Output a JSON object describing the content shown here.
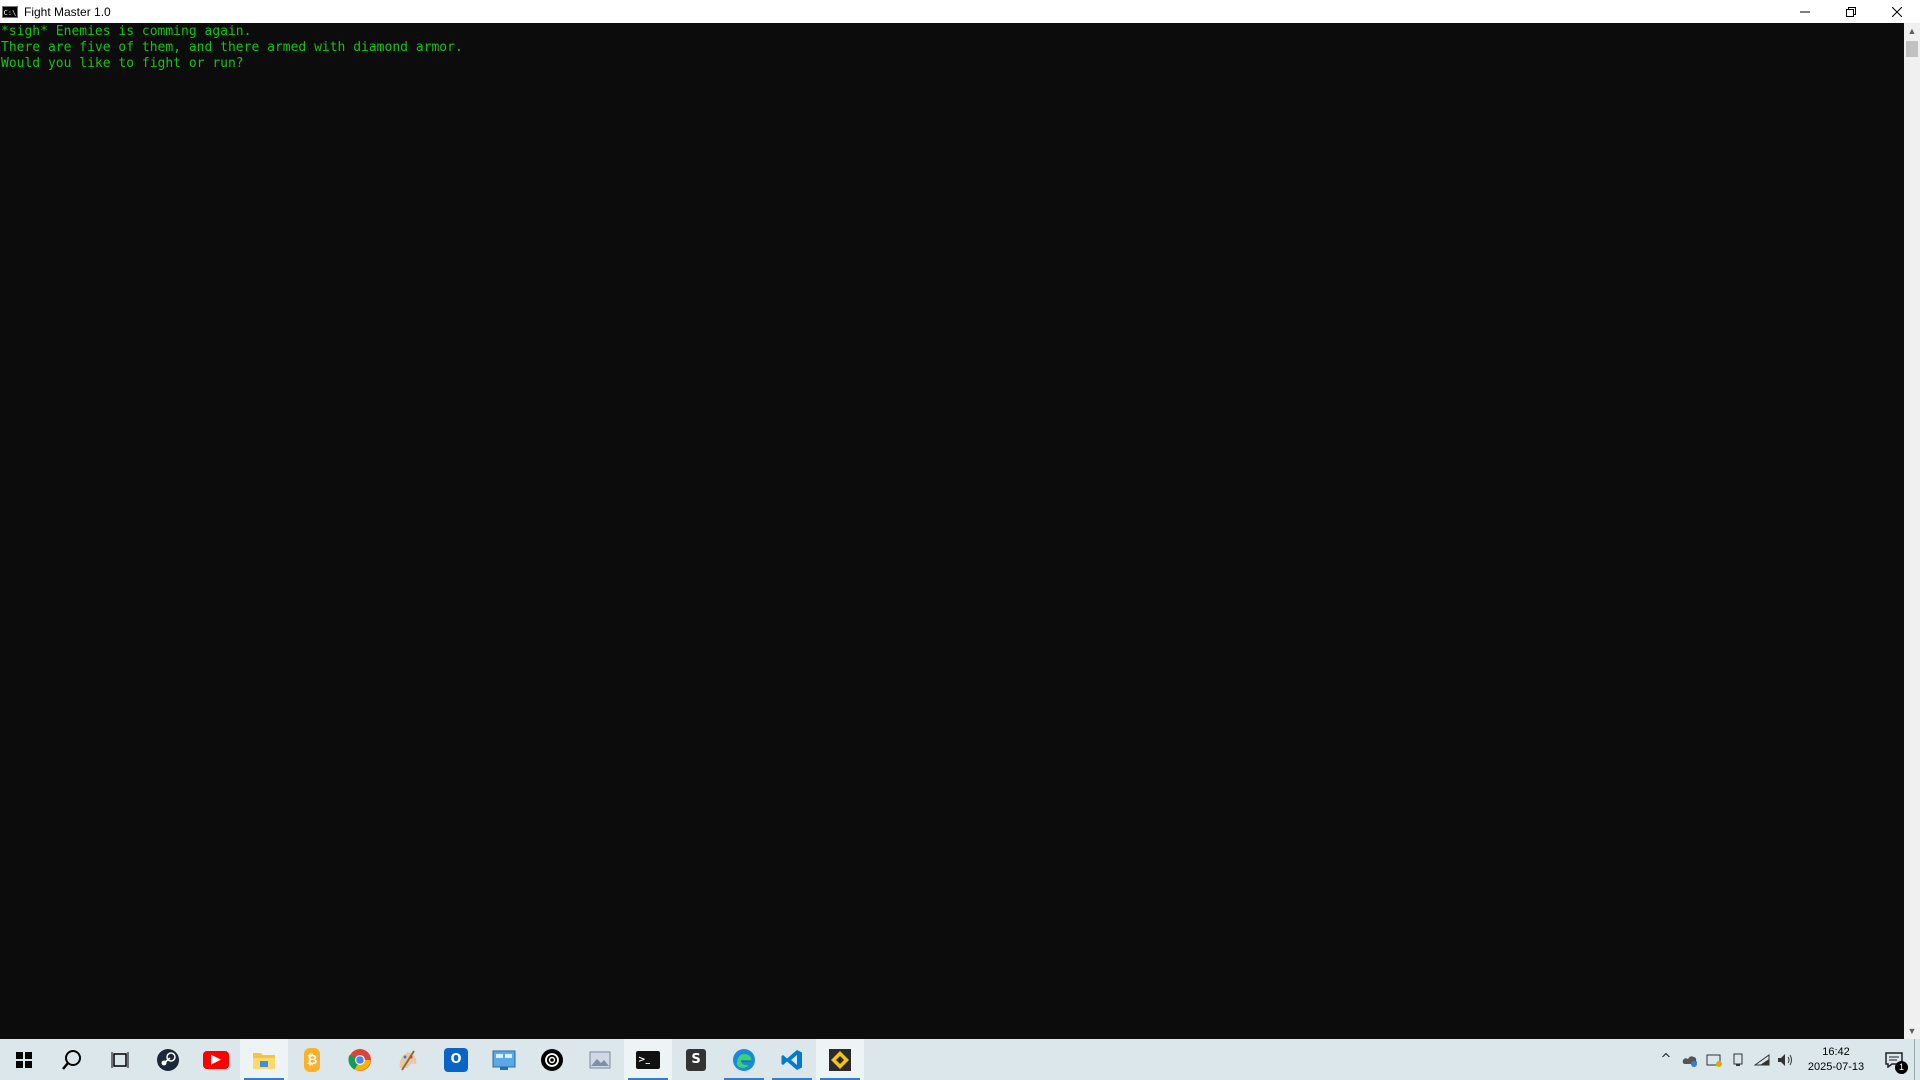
{
  "window": {
    "title": "Fight Master 1.0",
    "icon_label": "C:\\",
    "controls": {
      "minimize": "—",
      "restore": "❐",
      "close": "✕"
    }
  },
  "console": {
    "text_color": "#13c413",
    "background": "#0c0c0c",
    "lines": [
      "*sigh* Enemies is comming again.",
      "There are five of them, and there armed with diamond armor.",
      "Would you like to fight or run?"
    ]
  },
  "scrollbar": {
    "up": "▲",
    "down": "▼"
  },
  "taskbar": {
    "start_icon": "windows-logo-icon",
    "apps": [
      {
        "name": "search",
        "icon": "search-icon",
        "glyph": "⌕"
      },
      {
        "name": "task-view",
        "icon": "task-view-icon",
        "glyph": ""
      },
      {
        "name": "steam",
        "icon": "steam-icon",
        "glyph": ""
      },
      {
        "name": "youtube",
        "icon": "youtube-icon",
        "glyph": "▶"
      },
      {
        "name": "file-explorer",
        "icon": "folder-icon",
        "glyph": ""
      },
      {
        "name": "bitcoin",
        "icon": "bitcoin-icon",
        "glyph": "₿"
      },
      {
        "name": "chrome",
        "icon": "chrome-icon",
        "glyph": ""
      },
      {
        "name": "paint",
        "icon": "paint-icon",
        "glyph": ""
      },
      {
        "name": "outlook",
        "icon": "outlook-icon",
        "glyph": "O"
      },
      {
        "name": "control-panel",
        "icon": "control-panel-icon",
        "glyph": ""
      },
      {
        "name": "chatgpt",
        "icon": "chatgpt-icon",
        "glyph": ""
      },
      {
        "name": "photos",
        "icon": "photos-icon",
        "glyph": ""
      },
      {
        "name": "terminal",
        "icon": "terminal-icon",
        "glyph": ">_"
      },
      {
        "name": "sublime",
        "icon": "sublime-icon",
        "glyph": "S"
      },
      {
        "name": "edge",
        "icon": "edge-icon",
        "glyph": ""
      },
      {
        "name": "vscode",
        "icon": "vscode-icon",
        "glyph": ""
      },
      {
        "name": "game",
        "icon": "game-icon",
        "glyph": ""
      }
    ],
    "tray": {
      "chevron": "^",
      "time": "16:42",
      "date": "2025-07-13",
      "notification_count": "1"
    }
  }
}
